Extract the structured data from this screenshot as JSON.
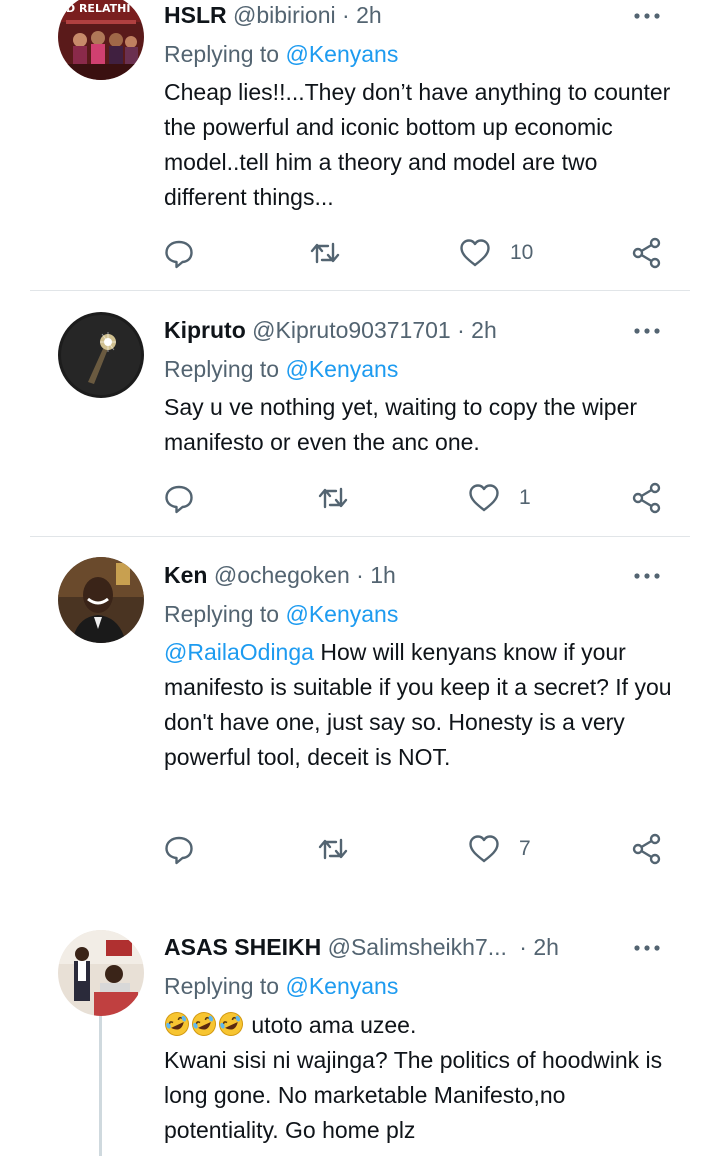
{
  "tweets": [
    {
      "name": "HSLR",
      "handle": "@bibirioni",
      "separator": "·",
      "time": "2h",
      "replying_prefix": "Replying to ",
      "replying_to": "@Kenyans",
      "text": "Cheap lies!!...They don’t have anything to counter the powerful and iconic bottom up economic model..tell him a theory and model are two different things...",
      "likes": "10",
      "avatar_text": "D RELATHI"
    },
    {
      "name": "Kipruto",
      "handle": "@Kipruto90371701",
      "separator": "·",
      "time": "2h",
      "replying_prefix": "Replying to ",
      "replying_to": "@Kenyans",
      "text": "Say u ve nothing yet, waiting to copy the wiper manifesto or even the anc one.",
      "likes": "1"
    },
    {
      "name": "Ken",
      "handle": "@ochegoken",
      "separator": "·",
      "time": "1h",
      "replying_prefix": "Replying to ",
      "replying_to": "@Kenyans",
      "text_mention": "@RailaOdinga",
      "text": " How will kenyans know if your manifesto is suitable if you keep it a secret? If you don't have one, just say so. Honesty is a very powerful tool, deceit is NOT.",
      "likes": "7"
    },
    {
      "name": "ASAS SHEIKH",
      "handle": "@Salimsheikh7...",
      "separator": "·",
      "time": "2h",
      "replying_prefix": "Replying to ",
      "replying_to": "@Kenyans",
      "text_line1": " utoto ama uzee.",
      "text_rest": "Kwani sisi ni wajinga? The politics of hoodwink is long gone. No marketable Manifesto,no potentiality.  Go home plz"
    }
  ],
  "icons": {
    "reply": "reply-icon",
    "retweet": "retweet-icon",
    "like": "heart-icon",
    "share": "share-icon",
    "more": "more-icon",
    "emoji": "rolling-laughing-emoji"
  },
  "colors": {
    "text": "#0f1419",
    "secondary": "#536471",
    "accent": "#1d9bf0",
    "divider": "#e1e5e8"
  }
}
